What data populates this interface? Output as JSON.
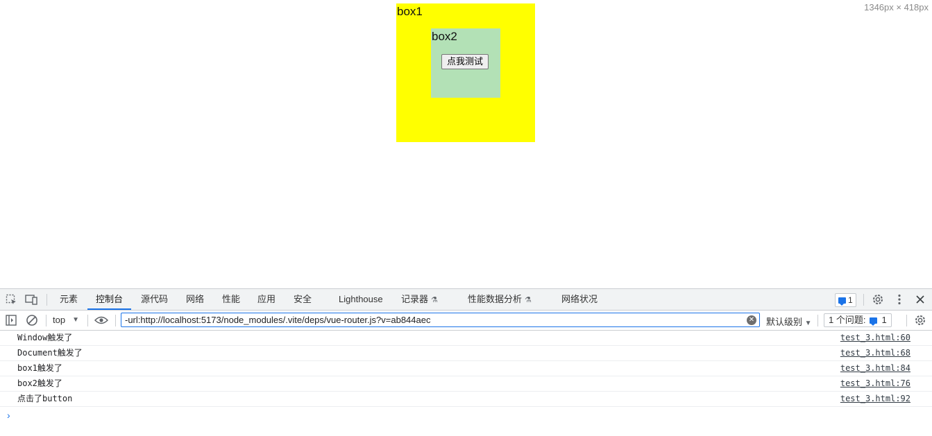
{
  "page": {
    "dims_label": "1346px × 418px",
    "box1_label": "box1",
    "box2_label": "box2",
    "button_label": "点我测试",
    "colors": {
      "box1": "#ffff00",
      "box2": "#b3e1b6"
    }
  },
  "devtools": {
    "tabs": [
      {
        "label": "元素"
      },
      {
        "label": "控制台",
        "active": true
      },
      {
        "label": "源代码"
      },
      {
        "label": "网络"
      },
      {
        "label": "性能"
      },
      {
        "label": "应用"
      },
      {
        "label": "安全"
      },
      {
        "label": "Lighthouse"
      },
      {
        "label": "记录器",
        "icon": "flask-icon"
      },
      {
        "label": "性能数据分析",
        "icon": "flask-icon"
      },
      {
        "label": "网络状况"
      }
    ],
    "issues_badge": "1",
    "toolbar": {
      "context": "top",
      "filter_value": "-url:http://localhost:5173/node_modules/.vite/deps/vue-router.js?v=ab844aec",
      "levels": "默认级别",
      "issues_label": "1 个问题:",
      "issues_count": "1"
    },
    "console": [
      {
        "message": "Window触发了",
        "source": "test_3.html:60"
      },
      {
        "message": "Document触发了",
        "source": "test_3.html:68"
      },
      {
        "message": "box1触发了",
        "source": "test_3.html:84"
      },
      {
        "message": "box2触发了",
        "source": "test_3.html:76"
      },
      {
        "message": "点击了button",
        "source": "test_3.html:92"
      }
    ],
    "prompt": "›"
  }
}
